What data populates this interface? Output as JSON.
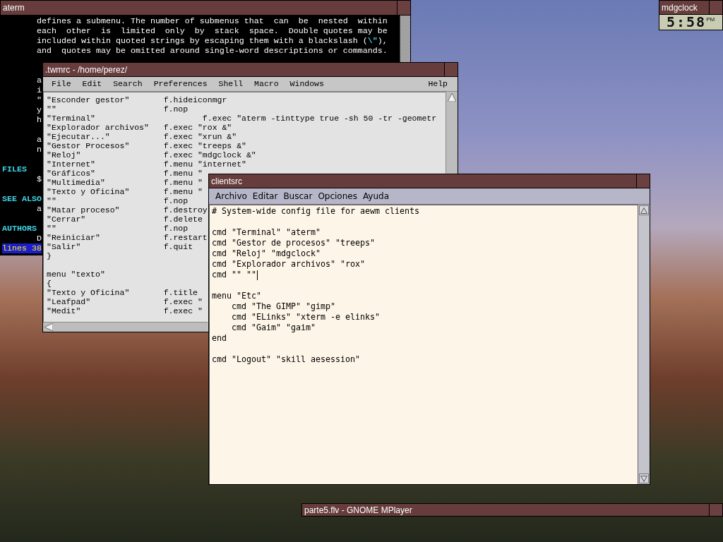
{
  "terminal_window": {
    "title": "aterm",
    "paragraphs": [
      [
        {
          "kind": "body",
          "text": "defines a submenu. The number of submenus that  can  be  nested  within"
        },
        {
          "kind": "body",
          "text": "each  other  is  limited  only  by  stack  space.  Double quotes may be"
        },
        {
          "kind": "body",
          "text": "included within quoted strings by escaping them with a blackslash (**\\\"**),"
        },
        {
          "kind": "body",
          "text": "and  quotes may be omitted around single-word descriptions or commands."
        }
      ],
      [
        {
          "kind": "body",
          "text": "a"
        },
        {
          "kind": "body",
          "text": "i"
        },
        {
          "kind": "body",
          "text": "\""
        },
        {
          "kind": "body",
          "text": "y"
        },
        {
          "kind": "body",
          "text": "h"
        }
      ],
      [
        {
          "kind": "body",
          "text": "a"
        },
        {
          "kind": "body",
          "text": "n"
        }
      ],
      [
        {
          "kind": "heading",
          "text": "FILES"
        },
        {
          "kind": "body",
          "text": "$"
        }
      ],
      [
        {
          "kind": "heading",
          "text": "SEE ALSO"
        },
        {
          "kind": "body",
          "text": "a"
        }
      ],
      [
        {
          "kind": "heading",
          "text": "AUTHORS"
        },
        {
          "kind": "body",
          "text": "D"
        },
        {
          "kind": "status",
          "text": "lines 38"
        }
      ]
    ]
  },
  "twmrc_window": {
    "title": ".twmrc - /home/perez/",
    "menu": [
      "File",
      "Edit",
      "Search",
      "Preferences",
      "Shell",
      "Macro",
      "Windows"
    ],
    "help_menu": "Help",
    "blocks": [
      [
        "\"Esconder gestor\"       f.hideiconmgr",
        "\"\"                      f.nop",
        "\"Terminal\"                      f.exec \"aterm -tinttype true -sh 50 -tr -geometr",
        "\"Explorador archivos\"   f.exec \"rox &\"",
        "\"Ejecutar...\"           f.exec \"xrun &\"",
        "\"Gestor Procesos\"       f.exec \"treeps &\"",
        "\"Reloj\"                 f.exec \"mdgclock &\"",
        "\"Internet\"              f.menu \"internet\"",
        "\"Gráficos\"              f.menu \"",
        "\"Multimedia\"            f.menu \"",
        "\"Texto y Oficina\"       f.menu \"",
        "\"\"                      f.nop",
        "\"Matar proceso\"         f.destroy",
        "\"Cerrar\"                f.delete",
        "\"\"                      f.nop",
        "\"Reiniciar\"             f.restart",
        "\"Salir\"                 f.quit",
        "}"
      ],
      [
        "menu \"texto\"",
        "{",
        "\"Texto y Oficina\"       f.title",
        "\"Leafpad\"               f.exec \"",
        "\"Medit\"                 f.exec \""
      ]
    ]
  },
  "clientsrc_window": {
    "title": "clientsrc",
    "menu": [
      "Archivo",
      "Editar",
      "Buscar",
      "Opciones",
      "Ayuda"
    ],
    "blocks": [
      [
        {
          "text": "# System-wide config file for aewm clients",
          "cursor": false
        }
      ],
      [
        {
          "text": "cmd \"Terminal\" \"aterm\"",
          "cursor": false
        },
        {
          "text": "cmd \"Gestor de procesos\" \"treeps\"",
          "cursor": false
        },
        {
          "text": "cmd \"Reloj\" \"mdgclock\"",
          "cursor": false
        },
        {
          "text": "cmd \"Explorador archivos\" \"rox\"",
          "cursor": false
        },
        {
          "text": "cmd \"\" \"\"",
          "cursor": true
        }
      ],
      [
        {
          "text": "menu \"Etc\"",
          "cursor": false
        },
        {
          "text": "    cmd \"The GIMP\" \"gimp\"",
          "cursor": false
        },
        {
          "text": "    cmd \"ELinks\" \"xterm -e elinks\"",
          "cursor": false
        },
        {
          "text": "    cmd \"Gaim\" \"gaim\"",
          "cursor": false
        },
        {
          "text": "end",
          "cursor": false
        }
      ],
      [
        {
          "text": "cmd \"Logout\" \"skill aesession\"",
          "cursor": false
        }
      ]
    ]
  },
  "clock_window": {
    "title": "mdgclock",
    "time": "5:58",
    "period": "PM"
  },
  "player_window": {
    "title": "parte5.flv - GNOME MPlayer"
  }
}
